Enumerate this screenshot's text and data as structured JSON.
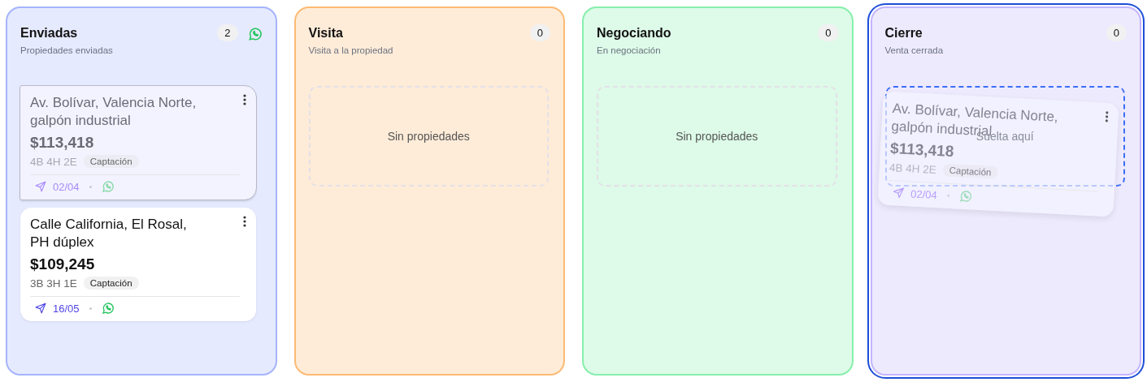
{
  "columns": [
    {
      "title": "Enviadas",
      "subtitle": "Propiedades enviadas",
      "count": "2",
      "color": "#a5b4fc",
      "whatsapp": true,
      "drop_active": false,
      "cards": [
        {
          "address": "Av. Bolívar, Valencia Norte, galpón industrial",
          "price": "$113,418",
          "specs": "4B 4H 2E",
          "tag": "Captación",
          "date": "02/04",
          "dragging": true
        },
        {
          "address": "Calle California, El Rosal, PH dúplex",
          "price": "$109,245",
          "specs": "3B 3H 1E",
          "tag": "Captación",
          "date": "16/05",
          "dragging": false
        }
      ]
    },
    {
      "title": "Visita",
      "subtitle": "Visita a la propiedad",
      "count": "0",
      "color": "#fdba74",
      "drop_active": false,
      "empty_text": "Sin propiedades"
    },
    {
      "title": "Negociando",
      "subtitle": "En negociación",
      "count": "0",
      "color": "#86efac",
      "drop_active": false,
      "empty_text": "Sin propiedades"
    },
    {
      "title": "Cierre",
      "subtitle": "Venta cerrada",
      "count": "0",
      "color": "#c4b5fd",
      "drop_active": true,
      "drop_text": "Suelta aquí",
      "drag_preview": {
        "address": "Av. Bolívar, Valencia Norte, galpón industrial",
        "price": "$113,418",
        "specs": "4B 4H 2E",
        "tag": "Captación",
        "date": "02/04"
      }
    }
  ]
}
